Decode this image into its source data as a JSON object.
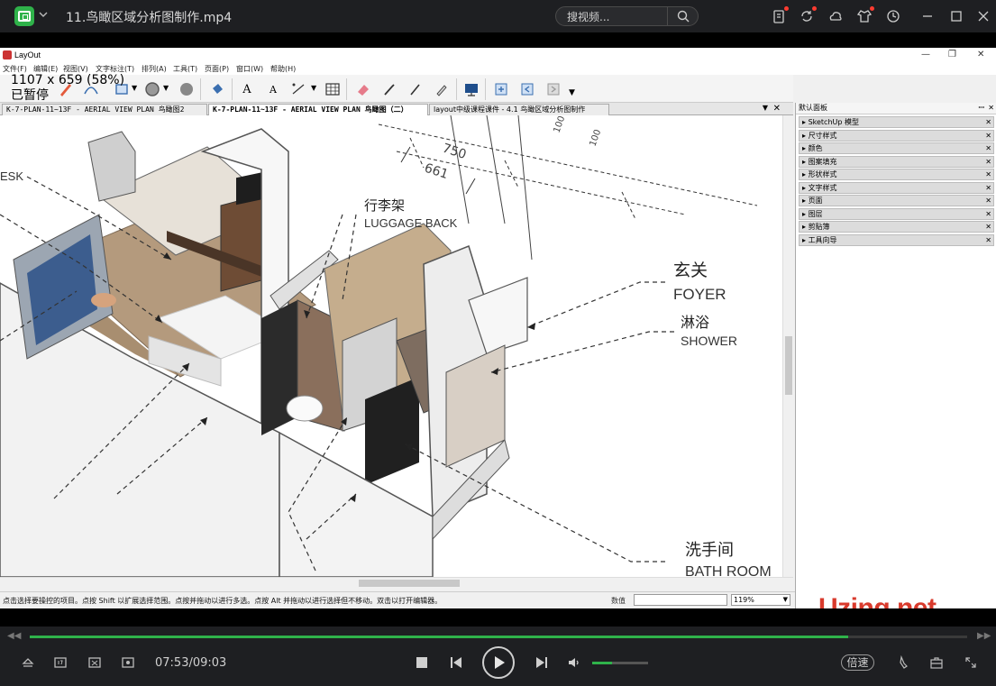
{
  "player": {
    "title": "11.鸟瞰区域分析图制作.mp4",
    "search_placeholder": "搜视频...",
    "time_current": "07:53",
    "time_sep": "/",
    "time_total": "09:03",
    "speed_label": "倍速",
    "progress_fraction": 0.873,
    "volume_fraction": 0.35,
    "accent_color": "#2fb24a"
  },
  "layout_app": {
    "window_title": "LayOut",
    "overlay_size": "1107 x 659 (58%)",
    "overlay_status": "已暂停",
    "menus": [
      "文件(F)",
      "编辑(E)",
      "视图(V)",
      "文字标注(T)",
      "排列(A)",
      "工具(T)",
      "页面(P)",
      "窗口(W)",
      "帮助(H)"
    ],
    "doc_tabs": [
      "K-7-PLAN-11~13F - AERIAL VIEW PLAN 鸟瞰图2",
      "K-7-PLAN-11~13F - AERIAL VIEW PLAN 鸟瞰图（二）",
      "layout中级课程课件 - 4.1 鸟瞰区域分析图制作"
    ],
    "status_text": "点击选择要操控的项目。点按 Shift 以扩展选择范围。点按并拖动以进行多选。点按 Alt 并拖动以进行选择但不移动。双击以打开编辑器。",
    "status_value_label": "数值",
    "zoom_value": "119%",
    "tray_title": "默认面板",
    "tray_items": [
      "SketchUp 模型",
      "尺寸样式",
      "颜色",
      "图案填充",
      "形状样式",
      "文字样式",
      "页面",
      "图层",
      "剪贴簿",
      "工具向导"
    ],
    "watermark": "Uzing.net"
  },
  "drawing": {
    "labels": {
      "desk": "ESK",
      "luggage_cn": "行李架",
      "luggage_en": "LUGGAGE BACK",
      "foyer_cn": "玄关",
      "foyer_en": "FOYER",
      "shower_cn": "淋浴",
      "shower_en": "SHOWER",
      "bath_cn": "洗手间",
      "bath_en": "BATH ROOM"
    },
    "dimensions": [
      "750",
      "661",
      "100",
      "100"
    ]
  }
}
